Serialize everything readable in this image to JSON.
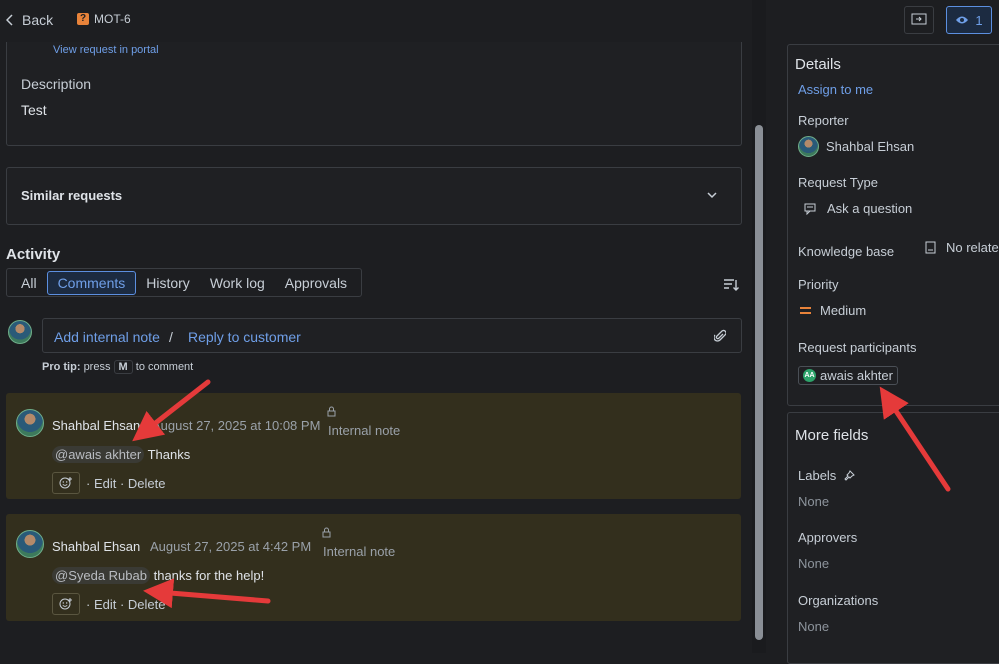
{
  "header": {
    "back_label": "Back",
    "ticket_key": "MOT-6",
    "watch_count": "1"
  },
  "request": {
    "portal_link": "View request in portal",
    "description_label": "Description",
    "description_value": "Test",
    "similar_label": "Similar requests"
  },
  "activity": {
    "title": "Activity",
    "tabs": [
      "All",
      "Comments",
      "History",
      "Work log",
      "Approvals"
    ],
    "active_tab": "Comments",
    "add_internal_note": "Add internal note",
    "separator": "/",
    "reply_to_customer": "Reply to customer",
    "pro_tip_bold": "Pro tip:",
    "pro_tip_pre": "press",
    "pro_tip_key": "M",
    "pro_tip_post": "to comment"
  },
  "comments": [
    {
      "author": "Shahbal Ehsan",
      "date": "August 27, 2025 at 10:08 PM",
      "visibility": "Internal note",
      "mention": "@awais akhter",
      "text": "Thanks",
      "edit": "Edit",
      "delete": "Delete"
    },
    {
      "author": "Shahbal Ehsan",
      "date": "August 27, 2025 at 4:42 PM",
      "visibility": "Internal note",
      "mention": "@Syeda Rubab",
      "text": "thanks for the help!",
      "edit": "Edit",
      "delete": "Delete"
    }
  ],
  "details": {
    "title": "Details",
    "assign_to_me": "Assign to me",
    "reporter_label": "Reporter",
    "reporter_value": "Shahbal Ehsan",
    "request_type_label": "Request Type",
    "request_type_value": "Ask a question",
    "knowledge_base_label": "Knowledge base",
    "knowledge_base_value": "No relate",
    "priority_label": "Priority",
    "priority_value": "Medium",
    "participants_label": "Request participants",
    "participant_initials": "AA",
    "participant_name": "awais akhter"
  },
  "more_fields": {
    "title": "More fields",
    "labels_label": "Labels",
    "labels_value": "None",
    "approvers_label": "Approvers",
    "approvers_value": "None",
    "organizations_label": "Organizations",
    "organizations_value": "None"
  },
  "colors": {
    "accent": "#6f9fe8",
    "note_bg": "#332f1d",
    "annotation_arrow": "#e53a3a",
    "priority": "#e8833a"
  }
}
